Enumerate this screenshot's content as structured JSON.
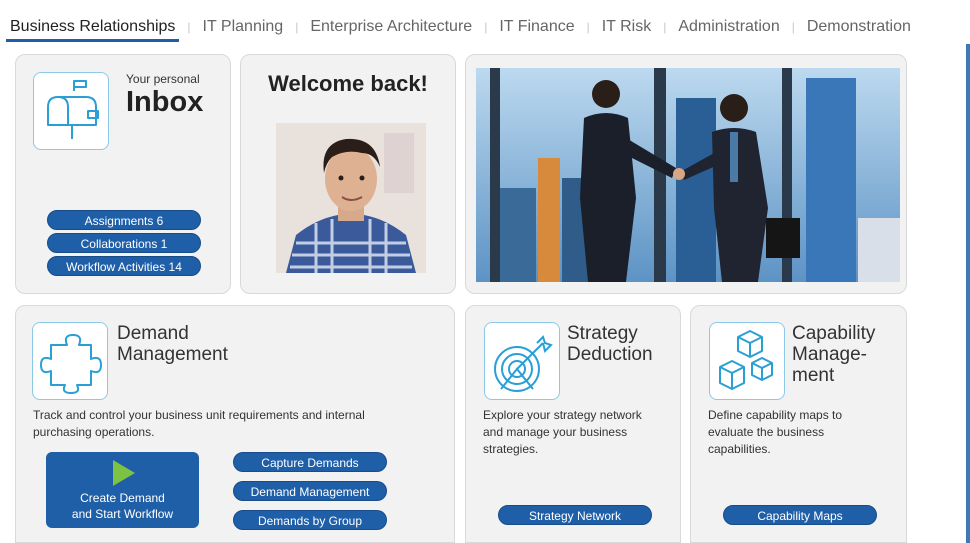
{
  "tabs": [
    "Business Relationships",
    "IT Planning",
    "Enterprise Architecture",
    "IT Finance",
    "IT Risk",
    "Administration",
    "Demonstration"
  ],
  "inbox": {
    "label_small": "Your personal",
    "label_big": "Inbox",
    "icon": "mailbox-icon",
    "buttons": [
      "Assignments 6",
      "Collaborations 1",
      "Workflow Activities 14"
    ]
  },
  "welcome": {
    "title": "Welcome back!",
    "avatar": "user-portrait"
  },
  "hero": {
    "image": "business-handshake-photo"
  },
  "demand": {
    "icon": "puzzle-icon",
    "title_line1": "Demand",
    "title_line2": "Management",
    "desc_line1": "Track and control your business unit requirements and internal",
    "desc_line2": "purchasing operations.",
    "start_button_line1": "Create Demand",
    "start_button_line2": "and Start Workflow",
    "buttons": [
      "Capture Demands",
      "Demand Management",
      "Demands by Group"
    ]
  },
  "strategy": {
    "icon": "target-icon",
    "title_line1": "Strategy",
    "title_line2": "Deduction",
    "desc_lines": [
      "Explore your strategy network",
      "and manage your business",
      "strategies."
    ],
    "button": "Strategy Network"
  },
  "capability": {
    "icon": "cubes-icon",
    "title_lines": [
      "Capability",
      "Manage-",
      "ment"
    ],
    "desc_lines": [
      "Define capability maps to",
      "evaluate the business",
      "capabilities."
    ],
    "button": "Capability Maps"
  },
  "colors": {
    "accent": "#1f5fa8",
    "card_bg": "#f2f2f2",
    "icon_border": "#8cc8e8",
    "play_green": "#7dc242"
  }
}
